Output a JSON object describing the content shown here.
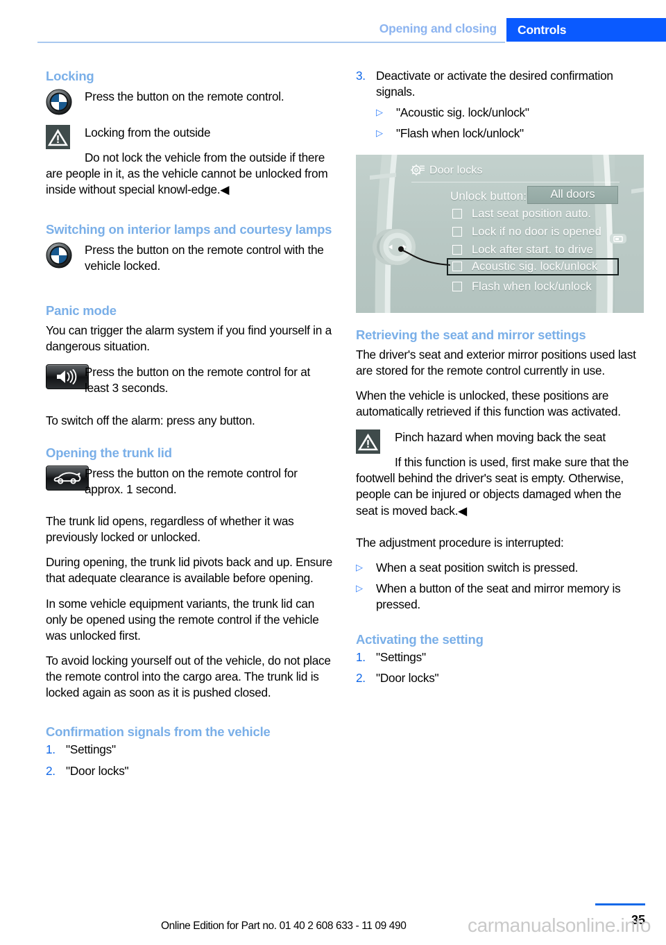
{
  "header": {
    "section_label": "Opening and closing",
    "chapter_label": "Controls"
  },
  "left_column": {
    "locking": {
      "heading": "Locking",
      "remote_instruction": "Press the button on the remote control.",
      "warning_title": "Locking from the outside",
      "warning_body": "Do not lock the vehicle from the outside if there are people in it, as the vehicle cannot be unlocked from inside without special knowl-edge.◀"
    },
    "interior_lamps": {
      "heading": "Switching on interior lamps and courtesy lamps",
      "remote_instruction": "Press the button on the remote control with the vehicle locked."
    },
    "panic_mode": {
      "heading": "Panic mode",
      "intro": "You can trigger the alarm system if you find yourself in a dangerous situation.",
      "remote_instruction": "Press the button on the remote control for at least 3 seconds.",
      "switch_off": "To switch off the alarm: press any button."
    },
    "trunk_lid": {
      "heading": "Opening the trunk lid",
      "remote_instruction": "Press the button on the remote control for approx. 1 second.",
      "para1": "The trunk lid opens, regardless of whether it was previously locked or unlocked.",
      "para2": "During opening, the trunk lid pivots back and up. Ensure that adequate clearance is available before opening.",
      "para3": "In some vehicle equipment variants, the trunk lid can only be opened using the remote control if the vehicle was unlocked first.",
      "para4": "To avoid locking yourself out of the vehicle, do not place the remote control into the cargo area. The trunk lid is locked again as soon as it is pushed closed."
    },
    "confirmation_signals": {
      "heading": "Confirmation signals from the vehicle",
      "steps": [
        {
          "num": "1.",
          "text": "\"Settings\""
        },
        {
          "num": "2.",
          "text": "\"Door locks\""
        }
      ]
    }
  },
  "right_column": {
    "step3": {
      "num": "3.",
      "text": "Deactivate or activate the desired confirmation signals.",
      "sub_items": [
        "\"Acoustic sig. lock/unlock\"",
        "\"Flash when lock/unlock\""
      ]
    },
    "idrive_screen": {
      "title": "Door locks",
      "unlock_label": "Unlock button:",
      "unlock_value": "All doors",
      "options": [
        {
          "label": "Last seat position auto.",
          "checked": false,
          "highlighted": false
        },
        {
          "label": "Lock if no door is opened",
          "checked": false,
          "highlighted": false
        },
        {
          "label": "Lock after start. to drive",
          "checked": false,
          "highlighted": false
        },
        {
          "label": "Acoustic sig. lock/unlock",
          "checked": false,
          "highlighted": true
        },
        {
          "label": "Flash when lock/unlock",
          "checked": false,
          "highlighted": false
        }
      ]
    },
    "seat_mirror": {
      "heading": "Retrieving the seat and mirror settings",
      "para1": "The driver's seat and exterior mirror positions used last are stored for the remote control currently in use.",
      "para2": "When the vehicle is unlocked, these positions are automatically retrieved if this function was activated.",
      "warning_title": "Pinch hazard when moving back the seat",
      "warning_body": "If this function is used, first make sure that the footwell behind the driver's seat is empty. Otherwise, people can be injured or objects damaged when the seat is moved back.◀",
      "interrupt_intro": "The adjustment procedure is interrupted:",
      "interrupt_items": [
        "When a seat position switch is pressed.",
        "When a button of the seat and mirror memory is pressed."
      ]
    },
    "activating": {
      "heading": "Activating the setting",
      "steps": [
        {
          "num": "1.",
          "text": "\"Settings\""
        },
        {
          "num": "2.",
          "text": "\"Door locks\""
        }
      ]
    }
  },
  "footer": {
    "edition": "Online Edition for Part no. 01 40 2 608 633 - 11 09 490",
    "page_number": "35",
    "watermark": "carmanualsonline.info"
  },
  "colors": {
    "accent_blue": "#0a5aff",
    "heading_blue": "#7aafe8",
    "muted_blue": "#8cb4f0",
    "list_number_blue": "#1168e8"
  }
}
